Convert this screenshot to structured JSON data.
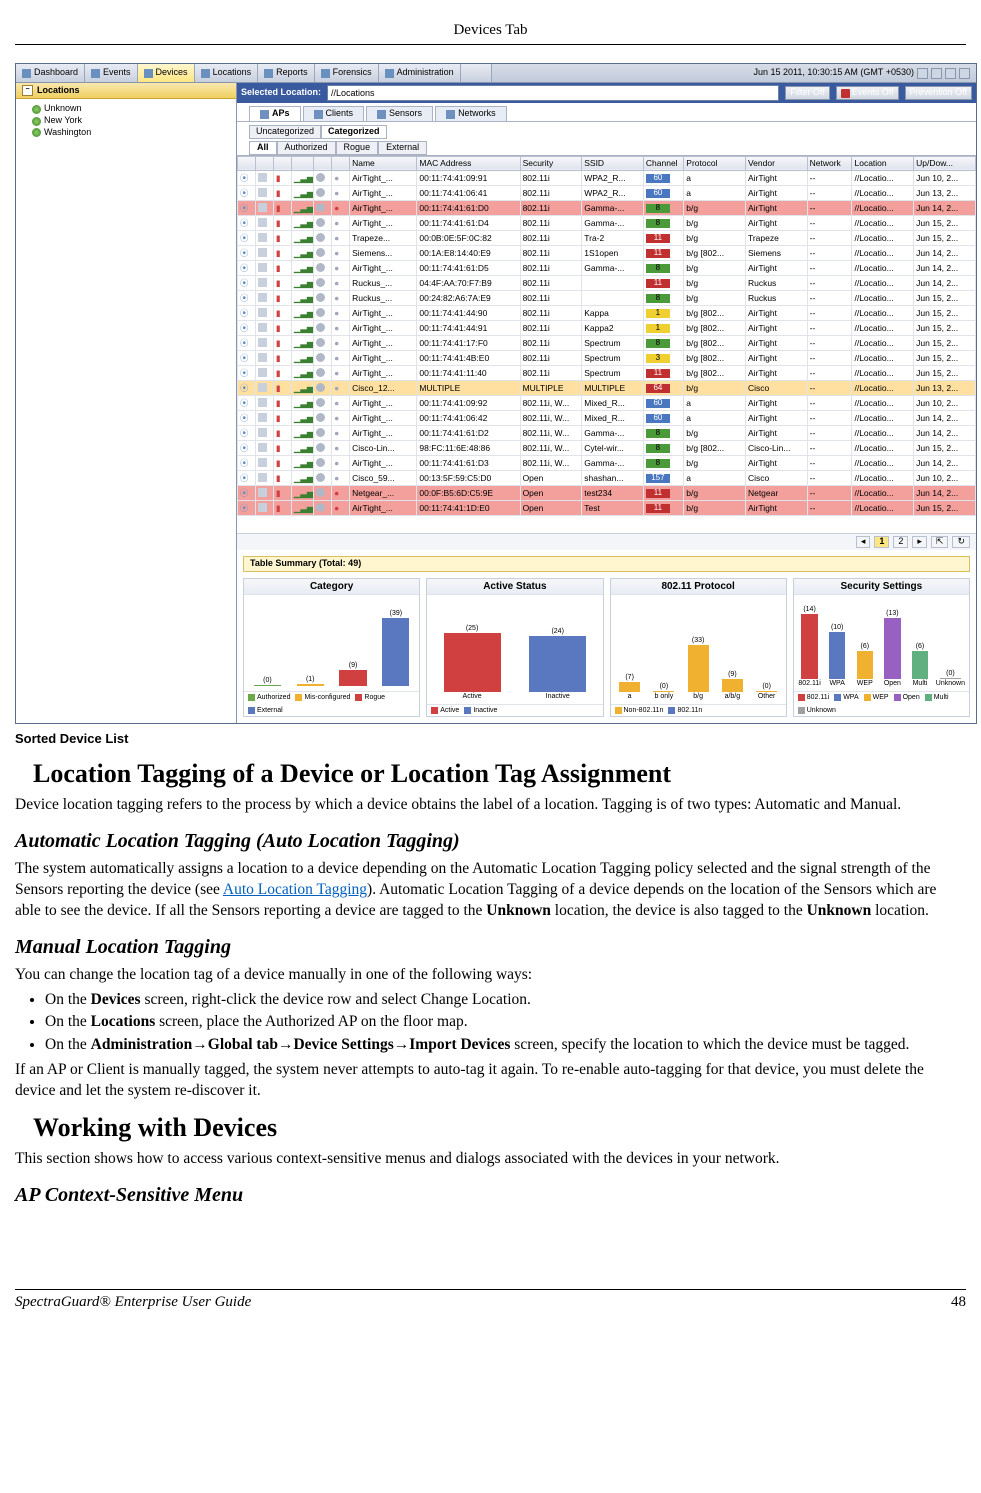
{
  "page": {
    "header": "Devices Tab",
    "caption": "Sorted Device List",
    "footer_left": "SpectraGuard® Enterprise User Guide",
    "footer_right": "48"
  },
  "content": {
    "h1a": "Location Tagging of a Device or Location Tag Assignment",
    "p1": "Device location tagging refers to the process by which a device obtains the label of a location. Tagging is of two types: Automatic and Manual.",
    "h2a": "Automatic Location Tagging (Auto Location Tagging)",
    "p2a": "The system automatically assigns a location to a device depending on the Automatic Location Tagging policy selected and the signal strength of the Sensors reporting the device (see ",
    "p2link": "Auto Location Tagging",
    "p2b": "). Automatic Location Tagging of a device depends on the location of the Sensors which are able to see the device. If all the Sensors reporting a device are tagged to the ",
    "p2bold1": "Unknown",
    "p2c": " location, the device is also tagged to the ",
    "p2bold2": "Unknown",
    "p2d": " location.",
    "h2b": "Manual Location Tagging",
    "p3": "You can change the location tag of a device manually in one of the following ways:",
    "li1a": "On the ",
    "li1b": "Devices",
    "li1c": " screen, right-click the device row and select Change Location.",
    "li2a": "On the ",
    "li2b": "Locations",
    "li2c": " screen, place the Authorized AP on the floor map.",
    "li3a": "On the ",
    "li3b": "Administration→Global tab→Device Settings→Import Devices",
    "li3c": " screen, specify the location to which the device must be tagged.",
    "p4": "If an AP or Client is manually tagged, the system never attempts to auto-tag it again. To re-enable auto-tagging for that device, you must delete the device and let the system re-discover it.",
    "h1b": "Working with Devices",
    "p5": "This section shows how to access various context-sensitive menus and dialogs associated with the devices in your network.",
    "h2c": "AP Context-Sensitive Menu"
  },
  "ui": {
    "toolbar_tabs": [
      "Dashboard",
      "Events",
      "Devices",
      "Locations",
      "Reports",
      "Forensics",
      "Administration"
    ],
    "toolbar_active": 2,
    "datetime": "Jun 15 2011, 10:30:15 AM (GMT +0530)",
    "sidebar_header": "Locations",
    "tree": [
      "Unknown",
      "New York",
      "Washington"
    ],
    "selected_loc_label": "Selected Location:",
    "selected_loc_value": "//Locations",
    "filter_off": "Filter Off",
    "events_off": "Events Off",
    "prevention_off": "Prevention Off",
    "device_tabs": [
      "APs",
      "Clients",
      "Sensors",
      "Networks"
    ],
    "device_tabs_sel": 0,
    "cat_tabs": [
      "Uncategorized",
      "Categorized"
    ],
    "cat_sel": 1,
    "filter_tabs": [
      "All",
      "Authorized",
      "Rogue",
      "External"
    ],
    "filter_sel": 0,
    "columns": [
      "",
      "",
      "",
      "",
      "",
      "",
      "Name",
      "MAC Address",
      "Security",
      "SSID",
      "Channel",
      "Protocol",
      "Vendor",
      "Network",
      "Location",
      "Up/Dow..."
    ],
    "pagination": {
      "current": "1",
      "next": "2"
    },
    "summary_title": "Table Summary (Total: 49)"
  },
  "rows": [
    {
      "cls": "row-normal",
      "name": "AirTight_...",
      "mac": "00:11:74:41:09:91",
      "sec": "802.11i",
      "ssid": "WPA2_R...",
      "ch": "60",
      "chcls": "b-blue",
      "proto": "a",
      "vendor": "AirTight",
      "net": "--",
      "loc": "//Locatio...",
      "upd": "Jun 10, 2..."
    },
    {
      "cls": "row-normal",
      "name": "AirTight_...",
      "mac": "00:11:74:41:06:41",
      "sec": "802.11i",
      "ssid": "WPA2_R...",
      "ch": "60",
      "chcls": "b-blue",
      "proto": "a",
      "vendor": "AirTight",
      "net": "--",
      "loc": "//Locatio...",
      "upd": "Jun 13, 2..."
    },
    {
      "cls": "row-red",
      "name": "AirTight_...",
      "mac": "00:11:74:41:61:D0",
      "sec": "802.11i",
      "ssid": "Gamma-...",
      "ch": "8",
      "chcls": "b-green",
      "proto": "b/g",
      "vendor": "AirTight",
      "net": "--",
      "loc": "//Locatio...",
      "upd": "Jun 14, 2..."
    },
    {
      "cls": "row-normal",
      "name": "AirTight_...",
      "mac": "00:11:74:41:61:D4",
      "sec": "802.11i",
      "ssid": "Gamma-...",
      "ch": "8",
      "chcls": "b-green",
      "proto": "b/g",
      "vendor": "AirTight",
      "net": "--",
      "loc": "//Locatio...",
      "upd": "Jun 15, 2..."
    },
    {
      "cls": "row-normal",
      "name": "Trapeze...",
      "mac": "00:0B:0E:5F:0C:82",
      "sec": "802.11i",
      "ssid": "Tra-2",
      "ch": "11",
      "chcls": "b-red",
      "proto": "b/g",
      "vendor": "Trapeze",
      "net": "--",
      "loc": "//Locatio...",
      "upd": "Jun 15, 2..."
    },
    {
      "cls": "row-normal",
      "name": "Siemens...",
      "mac": "00:1A:E8:14:40:E9",
      "sec": "802.11i",
      "ssid": "1S1open",
      "ch": "11",
      "chcls": "b-red",
      "proto": "b/g [802...",
      "vendor": "Siemens",
      "net": "--",
      "loc": "//Locatio...",
      "upd": "Jun 14, 2..."
    },
    {
      "cls": "row-normal",
      "name": "AirTight_...",
      "mac": "00:11:74:41:61:D5",
      "sec": "802.11i",
      "ssid": "Gamma-...",
      "ch": "8",
      "chcls": "b-green",
      "proto": "b/g",
      "vendor": "AirTight",
      "net": "--",
      "loc": "//Locatio...",
      "upd": "Jun 14, 2..."
    },
    {
      "cls": "row-normal",
      "name": "Ruckus_...",
      "mac": "04:4F:AA:70:F7:B9",
      "sec": "802.11i",
      "ssid": "",
      "ch": "11",
      "chcls": "b-red",
      "proto": "b/g",
      "vendor": "Ruckus",
      "net": "--",
      "loc": "//Locatio...",
      "upd": "Jun 14, 2..."
    },
    {
      "cls": "row-normal",
      "name": "Ruckus_...",
      "mac": "00:24:82:A6:7A:E9",
      "sec": "802.11i",
      "ssid": "",
      "ch": "8",
      "chcls": "b-green",
      "proto": "b/g",
      "vendor": "Ruckus",
      "net": "--",
      "loc": "//Locatio...",
      "upd": "Jun 15, 2..."
    },
    {
      "cls": "row-normal",
      "name": "AirTight_...",
      "mac": "00:11:74:41:44:90",
      "sec": "802.11i",
      "ssid": "Kappa",
      "ch": "1",
      "chcls": "b-yellow",
      "proto": "b/g [802...",
      "vendor": "AirTight",
      "net": "--",
      "loc": "//Locatio...",
      "upd": "Jun 15, 2..."
    },
    {
      "cls": "row-normal",
      "name": "AirTight_...",
      "mac": "00:11:74:41:44:91",
      "sec": "802.11i",
      "ssid": "Kappa2",
      "ch": "1",
      "chcls": "b-yellow",
      "proto": "b/g [802...",
      "vendor": "AirTight",
      "net": "--",
      "loc": "//Locatio...",
      "upd": "Jun 15, 2..."
    },
    {
      "cls": "row-normal",
      "name": "AirTight_...",
      "mac": "00:11:74:41:17:F0",
      "sec": "802.11i",
      "ssid": "Spectrum",
      "ch": "8",
      "chcls": "b-green",
      "proto": "b/g [802...",
      "vendor": "AirTight",
      "net": "--",
      "loc": "//Locatio...",
      "upd": "Jun 15, 2..."
    },
    {
      "cls": "row-normal",
      "name": "AirTight_...",
      "mac": "00:11:74:41:4B:E0",
      "sec": "802.11i",
      "ssid": "Spectrum",
      "ch": "3",
      "chcls": "b-yellow",
      "proto": "b/g [802...",
      "vendor": "AirTight",
      "net": "--",
      "loc": "//Locatio...",
      "upd": "Jun 15, 2..."
    },
    {
      "cls": "row-normal",
      "name": "AirTight_...",
      "mac": "00:11:74:41:11:40",
      "sec": "802.11i",
      "ssid": "Spectrum",
      "ch": "11",
      "chcls": "b-red",
      "proto": "b/g [802...",
      "vendor": "AirTight",
      "net": "--",
      "loc": "//Locatio...",
      "upd": "Jun 15, 2..."
    },
    {
      "cls": "row-orange",
      "name": "Cisco_12...",
      "mac": "MULTIPLE",
      "sec": "MULTIPLE",
      "ssid": "MULTIPLE",
      "ch": "64",
      "chcls": "b-red",
      "proto": "b/g",
      "vendor": "Cisco",
      "net": "--",
      "loc": "//Locatio...",
      "upd": "Jun 13, 2..."
    },
    {
      "cls": "row-normal",
      "name": "AirTight_...",
      "mac": "00:11:74:41:09:92",
      "sec": "802.11i, W...",
      "ssid": "Mixed_R...",
      "ch": "60",
      "chcls": "b-blue",
      "proto": "a",
      "vendor": "AirTight",
      "net": "--",
      "loc": "//Locatio...",
      "upd": "Jun 10, 2..."
    },
    {
      "cls": "row-normal",
      "name": "AirTight_...",
      "mac": "00:11:74:41:06:42",
      "sec": "802.11i, W...",
      "ssid": "Mixed_R...",
      "ch": "60",
      "chcls": "b-blue",
      "proto": "a",
      "vendor": "AirTight",
      "net": "--",
      "loc": "//Locatio...",
      "upd": "Jun 14, 2..."
    },
    {
      "cls": "row-normal",
      "name": "AirTight_...",
      "mac": "00:11:74:41:61:D2",
      "sec": "802.11i, W...",
      "ssid": "Gamma-...",
      "ch": "8",
      "chcls": "b-green",
      "proto": "b/g",
      "vendor": "AirTight",
      "net": "--",
      "loc": "//Locatio...",
      "upd": "Jun 14, 2..."
    },
    {
      "cls": "row-normal",
      "name": "Cisco-Lin...",
      "mac": "98:FC:11:6E:48:86",
      "sec": "802.11i, W...",
      "ssid": "Cytel-wir...",
      "ch": "8",
      "chcls": "b-green",
      "proto": "b/g [802...",
      "vendor": "Cisco-Lin...",
      "net": "--",
      "loc": "//Locatio...",
      "upd": "Jun 15, 2..."
    },
    {
      "cls": "row-normal",
      "name": "AirTight_...",
      "mac": "00:11:74:41:61:D3",
      "sec": "802.11i, W...",
      "ssid": "Gamma-...",
      "ch": "8",
      "chcls": "b-green",
      "proto": "b/g",
      "vendor": "AirTight",
      "net": "--",
      "loc": "//Locatio...",
      "upd": "Jun 14, 2..."
    },
    {
      "cls": "row-normal",
      "name": "Cisco_59...",
      "mac": "00:13:5F:59:C5:D0",
      "sec": "Open",
      "ssid": "shashan...",
      "ch": "157",
      "chcls": "b-blue",
      "proto": "a",
      "vendor": "Cisco",
      "net": "--",
      "loc": "//Locatio...",
      "upd": "Jun 10, 2..."
    },
    {
      "cls": "row-red",
      "name": "Netgear_...",
      "mac": "00:0F:B5:6D:C5:9E",
      "sec": "Open",
      "ssid": "test234",
      "ch": "11",
      "chcls": "b-red",
      "proto": "b/g",
      "vendor": "Netgear",
      "net": "--",
      "loc": "//Locatio...",
      "upd": "Jun 14, 2..."
    },
    {
      "cls": "row-red",
      "name": "AirTight_...",
      "mac": "00:11:74:41:1D:E0",
      "sec": "Open",
      "ssid": "Test",
      "ch": "11",
      "chcls": "b-red",
      "proto": "b/g",
      "vendor": "AirTight",
      "net": "--",
      "loc": "//Locatio...",
      "upd": "Jun 15, 2..."
    }
  ],
  "chart_data": [
    {
      "type": "bar",
      "title": "Category",
      "ylim": [
        0,
        40
      ],
      "categories": [
        "Authorized",
        "Mis-configured",
        "Rogue",
        "External"
      ],
      "colors": [
        "#6aa84a",
        "#f0b030",
        "#d04040",
        "#5a78c0"
      ],
      "values": [
        0,
        1,
        9,
        39
      ]
    },
    {
      "type": "bar",
      "title": "Active Status",
      "ylim": [
        0,
        30
      ],
      "categories": [
        "Active",
        "Inactive"
      ],
      "colors": [
        "#d04040",
        "#5a78c0"
      ],
      "values": [
        25,
        24
      ]
    },
    {
      "type": "bar",
      "title": "802.11 Protocol",
      "ylim": [
        0,
        50
      ],
      "categories": [
        "a",
        "b only",
        "b/g",
        "a/b/g",
        "Other"
      ],
      "values": [
        7,
        0,
        33,
        9,
        0
      ],
      "legend": [
        "Non-802.11n",
        "802.11n"
      ],
      "legend_colors": [
        "#f0b030",
        "#5a78c0"
      ]
    },
    {
      "type": "bar",
      "title": "Security Settings",
      "ylim": [
        0,
        15
      ],
      "categories": [
        "802.11i",
        "WPA",
        "WEP",
        "Open",
        "Multi",
        "Unknown"
      ],
      "colors": [
        "#d04040",
        "#5a78c0",
        "#f0b030",
        "#9860c0",
        "#60b080",
        "#a0a0a0"
      ],
      "values": [
        14,
        10,
        6,
        13,
        6,
        0
      ]
    }
  ]
}
